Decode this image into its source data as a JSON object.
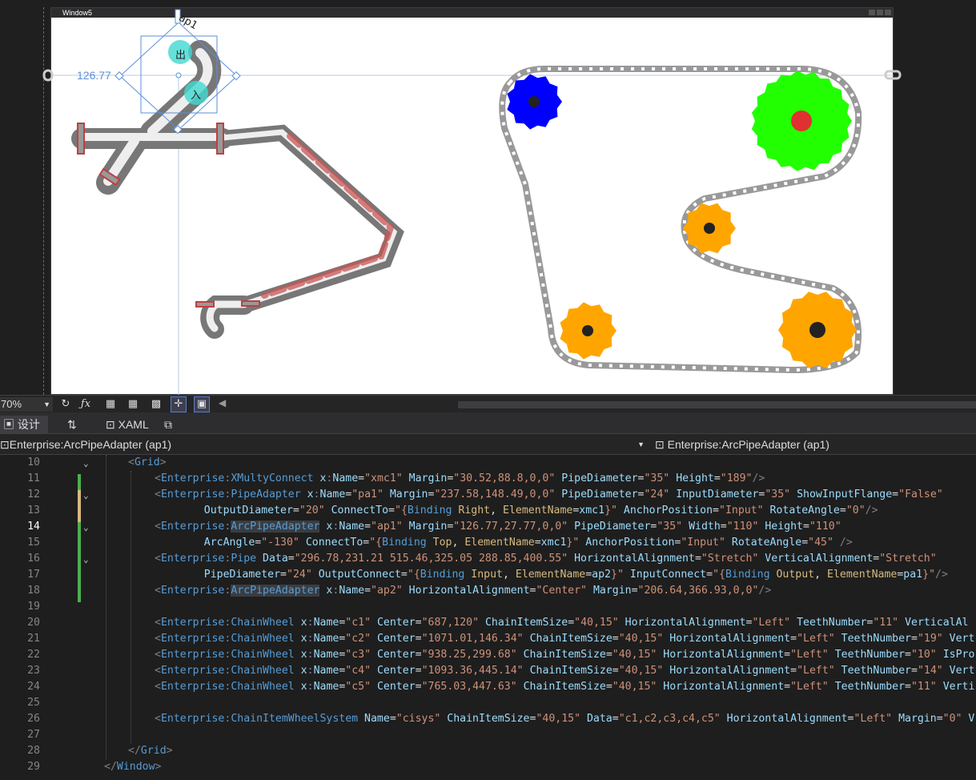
{
  "window": {
    "title": "Window5"
  },
  "designer": {
    "selected_name": "ap1",
    "margin_label": "126.77",
    "in_label": "入",
    "out_label": "出"
  },
  "chain_wheels": [
    {
      "name": "c1",
      "color": "#0000ff",
      "teeth": 11
    },
    {
      "name": "c2",
      "color": "#22ff00",
      "teeth": 19
    },
    {
      "name": "c3",
      "color": "#ffa500",
      "teeth": 10
    },
    {
      "name": "c4",
      "color": "#ffa500",
      "teeth": 14
    },
    {
      "name": "c5",
      "color": "#ffa500",
      "teeth": 11
    }
  ],
  "toolbar": {
    "zoom": "70%"
  },
  "tabs": {
    "design": "设计",
    "swap": "⇅",
    "xaml": "XAML"
  },
  "nav": {
    "left": "Enterprise:ArcPipeAdapter (ap1)",
    "right": "Enterprise:ArcPipeAdapter (ap1)"
  },
  "code": {
    "line_numbers": [
      "10",
      "11",
      "12",
      "13",
      "14",
      "15",
      "16",
      "17",
      "18",
      "19",
      "20",
      "21",
      "22",
      "23",
      "24",
      "25",
      "26",
      "27",
      "28",
      "29"
    ],
    "current_line": "14",
    "lines": [
      [
        [
          "t",
          "<"
        ],
        [
          "e",
          "Grid"
        ],
        [
          "t",
          ">"
        ]
      ],
      [
        [
          "t",
          "<"
        ],
        [
          "e",
          "Enterprise"
        ],
        [
          "t",
          ":"
        ],
        [
          "e",
          "XMultyConnect"
        ],
        [
          "p",
          " x"
        ],
        [
          "t",
          ":"
        ],
        [
          "p",
          "Name"
        ],
        [
          "b",
          "="
        ],
        [
          "s",
          "\"xmc1\""
        ],
        [
          "p",
          " Margin"
        ],
        [
          "b",
          "="
        ],
        [
          "s",
          "\"30.52,88.8,0,0\""
        ],
        [
          "p",
          " PipeDiameter"
        ],
        [
          "b",
          "="
        ],
        [
          "s",
          "\"35\""
        ],
        [
          "p",
          " Height"
        ],
        [
          "b",
          "="
        ],
        [
          "s",
          "\"189\""
        ],
        [
          "t",
          "/>"
        ]
      ],
      [
        [
          "t",
          "<"
        ],
        [
          "e",
          "Enterprise"
        ],
        [
          "t",
          ":"
        ],
        [
          "e",
          "PipeAdapter"
        ],
        [
          "p",
          " x"
        ],
        [
          "t",
          ":"
        ],
        [
          "p",
          "Name"
        ],
        [
          "b",
          "="
        ],
        [
          "s",
          "\"pa1\""
        ],
        [
          "p",
          " Margin"
        ],
        [
          "b",
          "="
        ],
        [
          "s",
          "\"237.58,148.49,0,0\""
        ],
        [
          "p",
          " PipeDiameter"
        ],
        [
          "b",
          "="
        ],
        [
          "s",
          "\"24\""
        ],
        [
          "p",
          " InputDiameter"
        ],
        [
          "b",
          "="
        ],
        [
          "s",
          "\"35\""
        ],
        [
          "p",
          " ShowInputFlange"
        ],
        [
          "b",
          "="
        ],
        [
          "s",
          "\"False\""
        ]
      ],
      [
        [
          "p",
          "    OutputDiameter"
        ],
        [
          "b",
          "="
        ],
        [
          "s",
          "\"20\""
        ],
        [
          "p",
          " ConnectTo"
        ],
        [
          "b",
          "="
        ],
        [
          "s",
          "\"{"
        ],
        [
          "e",
          "Binding"
        ],
        [
          "k",
          " Right"
        ],
        [
          "b",
          ", "
        ],
        [
          "k",
          "ElementName"
        ],
        [
          "b",
          "="
        ],
        [
          "p",
          "xmc1"
        ],
        [
          "s",
          "}\""
        ],
        [
          "p",
          " AnchorPosition"
        ],
        [
          "b",
          "="
        ],
        [
          "s",
          "\"Input\""
        ],
        [
          "p",
          " RotateAngle"
        ],
        [
          "b",
          "="
        ],
        [
          "s",
          "\"0\""
        ],
        [
          "t",
          "/>"
        ]
      ],
      [
        [
          "t",
          "<"
        ],
        [
          "e",
          "Enterprise"
        ],
        [
          "t",
          ":"
        ],
        [
          "e",
          "ArcPipeAdapter"
        ],
        [
          "p",
          " x"
        ],
        [
          "t",
          ":"
        ],
        [
          "p",
          "Name"
        ],
        [
          "b",
          "="
        ],
        [
          "s",
          "\"ap1\""
        ],
        [
          "p",
          " Margin"
        ],
        [
          "b",
          "="
        ],
        [
          "s",
          "\"126.77,27.77,0,0\""
        ],
        [
          "p",
          " PipeDiameter"
        ],
        [
          "b",
          "="
        ],
        [
          "s",
          "\"35\""
        ],
        [
          "p",
          " Width"
        ],
        [
          "b",
          "="
        ],
        [
          "s",
          "\"110\""
        ],
        [
          "p",
          " Height"
        ],
        [
          "b",
          "="
        ],
        [
          "s",
          "\"110\""
        ]
      ],
      [
        [
          "p",
          "    ArcAngle"
        ],
        [
          "b",
          "="
        ],
        [
          "s",
          "\"-130\""
        ],
        [
          "p",
          " ConnectTo"
        ],
        [
          "b",
          "="
        ],
        [
          "s",
          "\"{"
        ],
        [
          "e",
          "Binding"
        ],
        [
          "k",
          " Top"
        ],
        [
          "b",
          ", "
        ],
        [
          "k",
          "ElementName"
        ],
        [
          "b",
          "="
        ],
        [
          "p",
          "xmc1"
        ],
        [
          "s",
          "}\""
        ],
        [
          "p",
          " AnchorPosition"
        ],
        [
          "b",
          "="
        ],
        [
          "s",
          "\"Input\""
        ],
        [
          "p",
          " RotateAngle"
        ],
        [
          "b",
          "="
        ],
        [
          "s",
          "\"45\""
        ],
        [
          "t",
          " />"
        ]
      ],
      [
        [
          "t",
          "<"
        ],
        [
          "e",
          "Enterprise"
        ],
        [
          "t",
          ":"
        ],
        [
          "e",
          "Pipe"
        ],
        [
          "p",
          " Data"
        ],
        [
          "b",
          "="
        ],
        [
          "s",
          "\"296.78,231.21 515.46,325.05 288.85,400.55\""
        ],
        [
          "p",
          " HorizontalAlignment"
        ],
        [
          "b",
          "="
        ],
        [
          "s",
          "\"Stretch\""
        ],
        [
          "p",
          " VerticalAlignment"
        ],
        [
          "b",
          "="
        ],
        [
          "s",
          "\"Stretch\""
        ]
      ],
      [
        [
          "p",
          "    PipeDiameter"
        ],
        [
          "b",
          "="
        ],
        [
          "s",
          "\"24\""
        ],
        [
          "p",
          " OutputConnect"
        ],
        [
          "b",
          "="
        ],
        [
          "s",
          "\"{"
        ],
        [
          "e",
          "Binding"
        ],
        [
          "k",
          " Input"
        ],
        [
          "b",
          ", "
        ],
        [
          "k",
          "ElementName"
        ],
        [
          "b",
          "="
        ],
        [
          "p",
          "ap2"
        ],
        [
          "s",
          "}\""
        ],
        [
          "p",
          " InputConnect"
        ],
        [
          "b",
          "="
        ],
        [
          "s",
          "\"{"
        ],
        [
          "e",
          "Binding"
        ],
        [
          "k",
          " Output"
        ],
        [
          "b",
          ", "
        ],
        [
          "k",
          "ElementName"
        ],
        [
          "b",
          "="
        ],
        [
          "p",
          "pa1"
        ],
        [
          "s",
          "}\""
        ],
        [
          "t",
          "/>"
        ]
      ],
      [
        [
          "t",
          "<"
        ],
        [
          "e",
          "Enterprise"
        ],
        [
          "t",
          ":"
        ],
        [
          "e",
          "ArcPipeAdapter"
        ],
        [
          "p",
          " x"
        ],
        [
          "t",
          ":"
        ],
        [
          "p",
          "Name"
        ],
        [
          "b",
          "="
        ],
        [
          "s",
          "\"ap2\""
        ],
        [
          "p",
          " HorizontalAlignment"
        ],
        [
          "b",
          "="
        ],
        [
          "s",
          "\"Center\""
        ],
        [
          "p",
          " Margin"
        ],
        [
          "b",
          "="
        ],
        [
          "s",
          "\"206.64,366.93,0,0\""
        ],
        [
          "t",
          "/>"
        ]
      ],
      [],
      [
        [
          "t",
          "<"
        ],
        [
          "e",
          "Enterprise"
        ],
        [
          "t",
          ":"
        ],
        [
          "e",
          "ChainWheel"
        ],
        [
          "p",
          " x"
        ],
        [
          "t",
          ":"
        ],
        [
          "p",
          "Name"
        ],
        [
          "b",
          "="
        ],
        [
          "s",
          "\"c1\""
        ],
        [
          "p",
          " Center"
        ],
        [
          "b",
          "="
        ],
        [
          "s",
          "\"687,120\""
        ],
        [
          "p",
          " ChainItemSize"
        ],
        [
          "b",
          "="
        ],
        [
          "s",
          "\"40,15\""
        ],
        [
          "p",
          " HorizontalAlignment"
        ],
        [
          "b",
          "="
        ],
        [
          "s",
          "\"Left\""
        ],
        [
          "p",
          " TeethNumber"
        ],
        [
          "b",
          "="
        ],
        [
          "s",
          "\"11\""
        ],
        [
          "p",
          " VerticalAl"
        ]
      ],
      [
        [
          "t",
          "<"
        ],
        [
          "e",
          "Enterprise"
        ],
        [
          "t",
          ":"
        ],
        [
          "e",
          "ChainWheel"
        ],
        [
          "p",
          " x"
        ],
        [
          "t",
          ":"
        ],
        [
          "p",
          "Name"
        ],
        [
          "b",
          "="
        ],
        [
          "s",
          "\"c2\""
        ],
        [
          "p",
          " Center"
        ],
        [
          "b",
          "="
        ],
        [
          "s",
          "\"1071.01,146.34\""
        ],
        [
          "p",
          " ChainItemSize"
        ],
        [
          "b",
          "="
        ],
        [
          "s",
          "\"40,15\""
        ],
        [
          "p",
          " HorizontalAlignment"
        ],
        [
          "b",
          "="
        ],
        [
          "s",
          "\"Left\""
        ],
        [
          "p",
          " TeethNumber"
        ],
        [
          "b",
          "="
        ],
        [
          "s",
          "\"19\""
        ],
        [
          "p",
          " Vert"
        ]
      ],
      [
        [
          "t",
          "<"
        ],
        [
          "e",
          "Enterprise"
        ],
        [
          "t",
          ":"
        ],
        [
          "e",
          "ChainWheel"
        ],
        [
          "p",
          " x"
        ],
        [
          "t",
          ":"
        ],
        [
          "p",
          "Name"
        ],
        [
          "b",
          "="
        ],
        [
          "s",
          "\"c3\""
        ],
        [
          "p",
          " Center"
        ],
        [
          "b",
          "="
        ],
        [
          "s",
          "\"938.25,299.68\""
        ],
        [
          "p",
          " ChainItemSize"
        ],
        [
          "b",
          "="
        ],
        [
          "s",
          "\"40,15\""
        ],
        [
          "p",
          " HorizontalAlignment"
        ],
        [
          "b",
          "="
        ],
        [
          "s",
          "\"Left\""
        ],
        [
          "p",
          " TeethNumber"
        ],
        [
          "b",
          "="
        ],
        [
          "s",
          "\"10\""
        ],
        [
          "p",
          " IsPro"
        ]
      ],
      [
        [
          "t",
          "<"
        ],
        [
          "e",
          "Enterprise"
        ],
        [
          "t",
          ":"
        ],
        [
          "e",
          "ChainWheel"
        ],
        [
          "p",
          " x"
        ],
        [
          "t",
          ":"
        ],
        [
          "p",
          "Name"
        ],
        [
          "b",
          "="
        ],
        [
          "s",
          "\"c4\""
        ],
        [
          "p",
          " Center"
        ],
        [
          "b",
          "="
        ],
        [
          "s",
          "\"1093.36,445.14\""
        ],
        [
          "p",
          " ChainItemSize"
        ],
        [
          "b",
          "="
        ],
        [
          "s",
          "\"40,15\""
        ],
        [
          "p",
          " HorizontalAlignment"
        ],
        [
          "b",
          "="
        ],
        [
          "s",
          "\"Left\""
        ],
        [
          "p",
          " TeethNumber"
        ],
        [
          "b",
          "="
        ],
        [
          "s",
          "\"14\""
        ],
        [
          "p",
          " Vert"
        ]
      ],
      [
        [
          "t",
          "<"
        ],
        [
          "e",
          "Enterprise"
        ],
        [
          "t",
          ":"
        ],
        [
          "e",
          "ChainWheel"
        ],
        [
          "p",
          " x"
        ],
        [
          "t",
          ":"
        ],
        [
          "p",
          "Name"
        ],
        [
          "b",
          "="
        ],
        [
          "s",
          "\"c5\""
        ],
        [
          "p",
          " Center"
        ],
        [
          "b",
          "="
        ],
        [
          "s",
          "\"765.03,447.63\""
        ],
        [
          "p",
          " ChainItemSize"
        ],
        [
          "b",
          "="
        ],
        [
          "s",
          "\"40,15\""
        ],
        [
          "p",
          " HorizontalAlignment"
        ],
        [
          "b",
          "="
        ],
        [
          "s",
          "\"Left\""
        ],
        [
          "p",
          " TeethNumber"
        ],
        [
          "b",
          "="
        ],
        [
          "s",
          "\"11\""
        ],
        [
          "p",
          " Verti"
        ]
      ],
      [],
      [
        [
          "t",
          "<"
        ],
        [
          "e",
          "Enterprise"
        ],
        [
          "t",
          ":"
        ],
        [
          "e",
          "ChainItemWheelSystem"
        ],
        [
          "p",
          " Name"
        ],
        [
          "b",
          "="
        ],
        [
          "s",
          "\"cisys\""
        ],
        [
          "p",
          " ChainItemSize"
        ],
        [
          "b",
          "="
        ],
        [
          "s",
          "\"40,15\""
        ],
        [
          "p",
          " Data"
        ],
        [
          "b",
          "="
        ],
        [
          "s",
          "\"c1,c2,c3,c4,c5\""
        ],
        [
          "p",
          " HorizontalAlignment"
        ],
        [
          "b",
          "="
        ],
        [
          "s",
          "\"Left\""
        ],
        [
          "p",
          " Margin"
        ],
        [
          "b",
          "="
        ],
        [
          "s",
          "\"0\""
        ],
        [
          "p",
          " V"
        ]
      ],
      [],
      [
        [
          "t",
          "</"
        ],
        [
          "e",
          "Grid"
        ],
        [
          "t",
          ">"
        ]
      ],
      [
        [
          "t",
          "</"
        ],
        [
          "e",
          "Window"
        ],
        [
          "t",
          ">"
        ]
      ]
    ]
  }
}
